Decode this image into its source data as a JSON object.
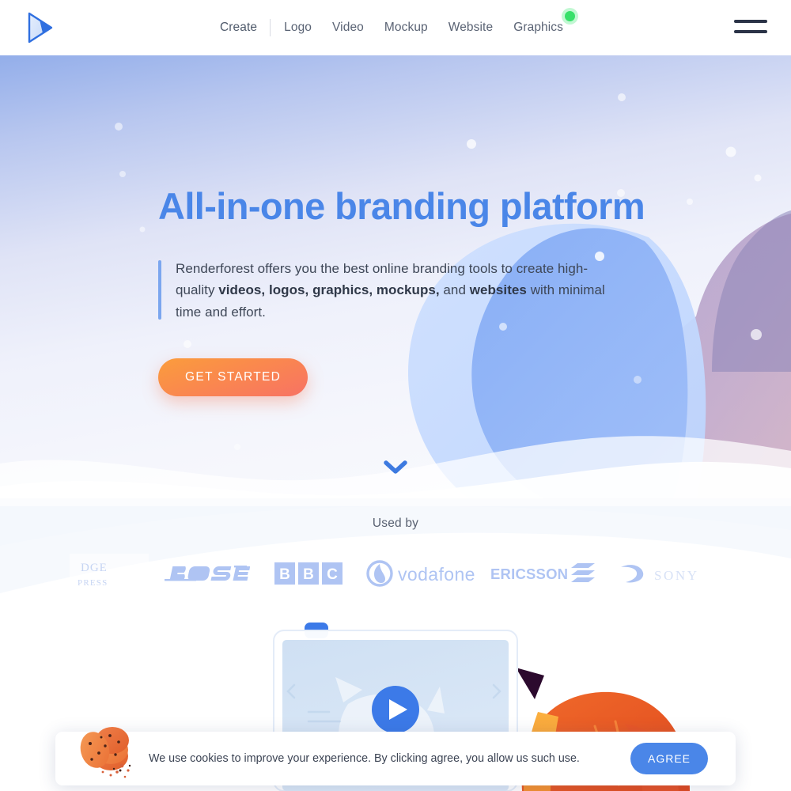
{
  "header": {
    "logo_name": "renderforest-play-logo",
    "nav": [
      {
        "label": "Create",
        "badge": null
      },
      {
        "label": "Logo",
        "badge": null
      },
      {
        "label": "Video",
        "badge": null
      },
      {
        "label": "Mockup",
        "badge": null
      },
      {
        "label": "Website",
        "badge": null
      },
      {
        "label": "Graphics",
        "badge": "new-dot"
      }
    ],
    "menu_icon": "hamburger-icon"
  },
  "hero": {
    "title": "All-in-one branding platform",
    "paragraph": {
      "part1": "Renderforest offers you the best online branding tools to create high-quality ",
      "bold1": "videos, logos, graphics, mockups,",
      "part2": " and ",
      "bold2": "websites",
      "part3": " with minimal time and effort."
    },
    "cta_label": "GET STARTED",
    "scroll_icon": "chevron-down-icon"
  },
  "usedby": {
    "label": "Used by",
    "brands": [
      {
        "name": "cambridge-university-press",
        "text_top": "DGE",
        "text_bottom": "PRESS"
      },
      {
        "name": "bose",
        "text": "BOSE"
      },
      {
        "name": "bbc",
        "letters": [
          "B",
          "B",
          "C"
        ]
      },
      {
        "name": "vodafone",
        "text": "vodafone"
      },
      {
        "name": "ericsson",
        "text": "ERICSSON"
      },
      {
        "name": "sony",
        "text": "SONY"
      }
    ]
  },
  "showcase": {
    "play_icon": "play-button-icon",
    "illustration": "fox-character-illustration"
  },
  "cookie": {
    "message": "We use cookies to improve your experience. By clicking agree, you allow us such use.",
    "button_label": "AGREE",
    "image_name": "cookies-illustration"
  },
  "colors": {
    "brand_blue": "#4a86e8",
    "heading_blue": "#4a86e8",
    "cta_orange": "#fb9d3c",
    "cta_pink": "#f87264",
    "badge_green": "#38e06a",
    "logo_tint": "#a9c0f2",
    "dark_text": "#2b3347"
  }
}
